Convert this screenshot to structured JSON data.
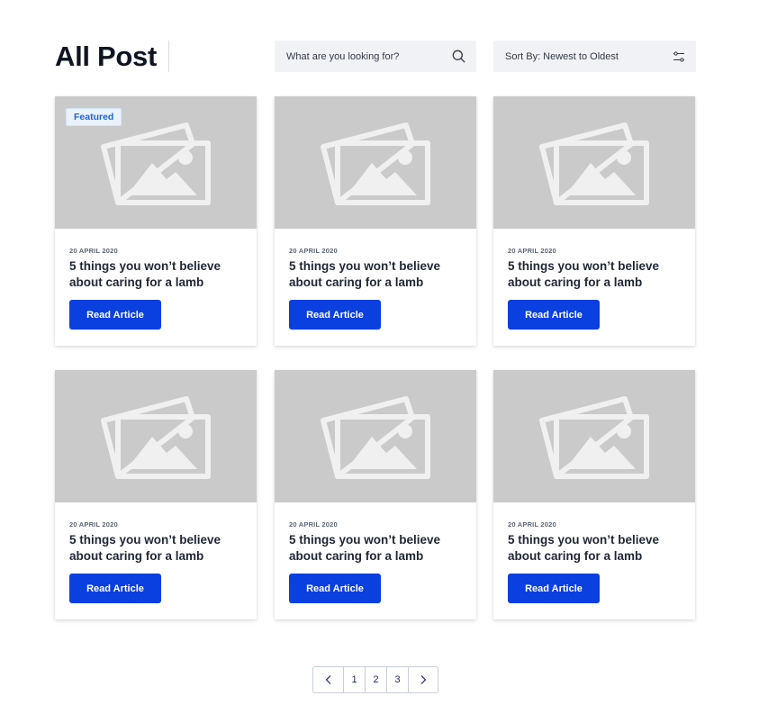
{
  "header": {
    "title": "All Post",
    "search": {
      "placeholder": "What are you looking for?",
      "icon": "search-icon"
    },
    "sort": {
      "label": "Sort By: Newest to Oldest",
      "icon": "filter-sliders-icon"
    }
  },
  "cards": [
    {
      "badge": "Featured",
      "date": "20 APRIL 2020",
      "title": "5 things you won’t believe about caring for a lamb",
      "button": "Read Article",
      "image_icon": "image-placeholder-icon"
    },
    {
      "date": "20 APRIL 2020",
      "title": "5 things you won’t believe about caring for a lamb",
      "button": "Read Article",
      "image_icon": "image-placeholder-icon"
    },
    {
      "date": "20 APRIL 2020",
      "title": "5 things you won’t believe about caring for a lamb",
      "button": "Read Article",
      "image_icon": "image-placeholder-icon"
    },
    {
      "date": "20 APRIL 2020",
      "title": "5 things you won’t believe about caring for a lamb",
      "button": "Read Article",
      "image_icon": "image-placeholder-icon"
    },
    {
      "date": "20 APRIL 2020",
      "title": "5 things you won’t believe about caring for a lamb",
      "button": "Read Article",
      "image_icon": "image-placeholder-icon"
    },
    {
      "date": "20 APRIL 2020",
      "title": "5 things you won’t believe about caring for a lamb",
      "button": "Read Article",
      "image_icon": "image-placeholder-icon"
    }
  ],
  "pagination": {
    "prev_icon": "chevron-left-icon",
    "next_icon": "chevron-right-icon",
    "pages": [
      "1",
      "2",
      "3"
    ]
  },
  "colors": {
    "primary": "#0a3fe0",
    "badge_text": "#1f63d6",
    "placeholder_bg": "#cacaca",
    "control_bg": "#f1f2f5"
  }
}
